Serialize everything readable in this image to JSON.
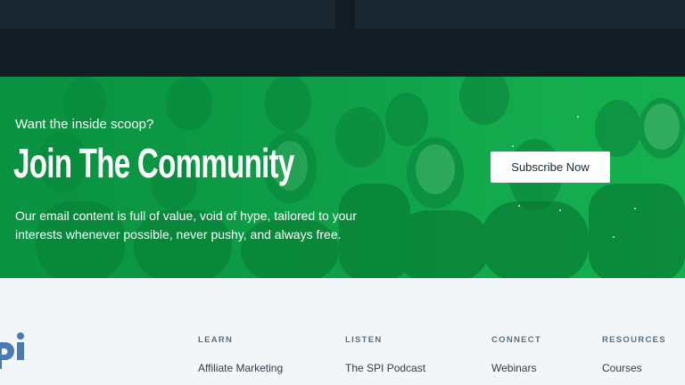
{
  "banner": {
    "eyebrow": "Want the inside scoop?",
    "headline": "Join The Community",
    "body": "Our email content is full of value, void of hype, tailored to your interests whenever possible, never pushy, and always free.",
    "cta_label": "Subscribe Now"
  },
  "footer": {
    "columns": [
      {
        "heading": "LEARN",
        "first_link": "Affiliate Marketing"
      },
      {
        "heading": "LISTEN",
        "first_link": "The SPI Podcast"
      },
      {
        "heading": "CONNECT",
        "first_link": "Webinars"
      },
      {
        "heading": "RESOURCES",
        "first_link": "Courses"
      }
    ]
  },
  "colors": {
    "banner_green": "#10a54a",
    "top_dark": "#141c24",
    "footer_bg": "#f3f6f8",
    "logo_blue": "#4b7ab0"
  },
  "icons": {
    "logo": "spi-logo"
  }
}
